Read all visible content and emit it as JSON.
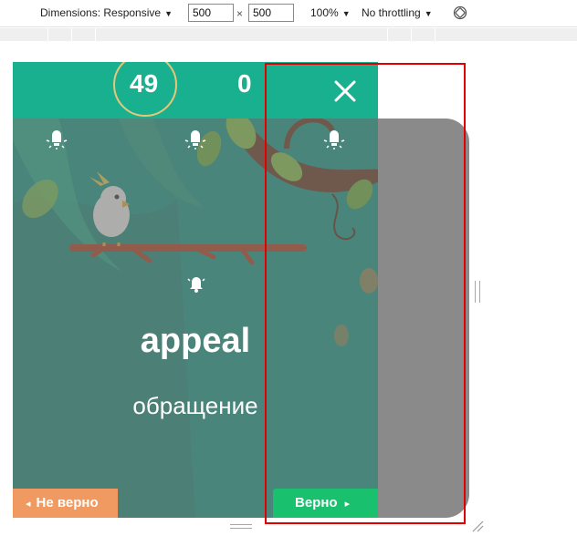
{
  "devtools": {
    "dimensions_label": "Dimensions: Responsive",
    "width_value": "500",
    "height_value": "500",
    "separator": "×",
    "zoom_label": "100%",
    "throttling_label": "No throttling",
    "dropdown_arrow": "▼",
    "rotate_icon": "rotate-icon"
  },
  "game": {
    "timer_value": "49",
    "score_value": "0",
    "close_icon": "close-icon",
    "hint_icons": [
      "lightbulb-icon",
      "lightbulb-icon",
      "lightbulb-icon"
    ],
    "sound_icon": "bell-icon",
    "word": "appeal",
    "translation": "обращение",
    "wrong_button": {
      "arrow": "◂",
      "label": "Не верно"
    },
    "right_button": {
      "label": "Верно",
      "arrow": "▸"
    },
    "colors": {
      "topbar": "#19b08f",
      "background": "#1a9b88",
      "timer_ring": "#e7c67a",
      "wrong_button": "#f09a61",
      "right_button": "#19c06e",
      "highlight_box": "#e00000"
    }
  }
}
